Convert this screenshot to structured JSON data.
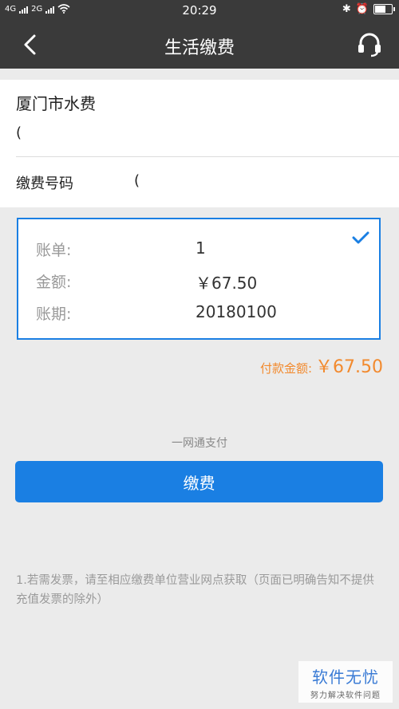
{
  "status_bar": {
    "network_left": "4G",
    "network_right": "2G",
    "time": "20:29",
    "bluetooth_glyph": "✱",
    "alarm_glyph": "⏰"
  },
  "nav": {
    "title": "生活缴费",
    "back_icon": "chevron-left-icon",
    "service_icon": "headset-icon"
  },
  "bill_info": {
    "name": "厦门市水费",
    "sub_value": "(",
    "pay_number_label": "缴费号码",
    "pay_number_value": "("
  },
  "bill_item": {
    "selected": true,
    "bill_label": "账单:",
    "bill_value": "1",
    "amount_label": "金额:",
    "amount_value": "￥67.50",
    "period_label": "账期:",
    "period_value": "20180100"
  },
  "total": {
    "label": "付款金额:",
    "value": "￥67.50"
  },
  "payment": {
    "method": "一网通支付",
    "button_label": "缴费"
  },
  "notice": "1.若需发票，请至相应缴费单位营业网点获取（页面已明确告知不提供充值发票的除外）",
  "watermark": {
    "title": "软件无忧",
    "subtitle": "努力解决软件问题"
  },
  "colors": {
    "header_bg": "#3a3a3a",
    "accent_blue": "#1a7fe3",
    "amount_orange": "#f28a2e",
    "page_bg": "#ebebeb"
  }
}
